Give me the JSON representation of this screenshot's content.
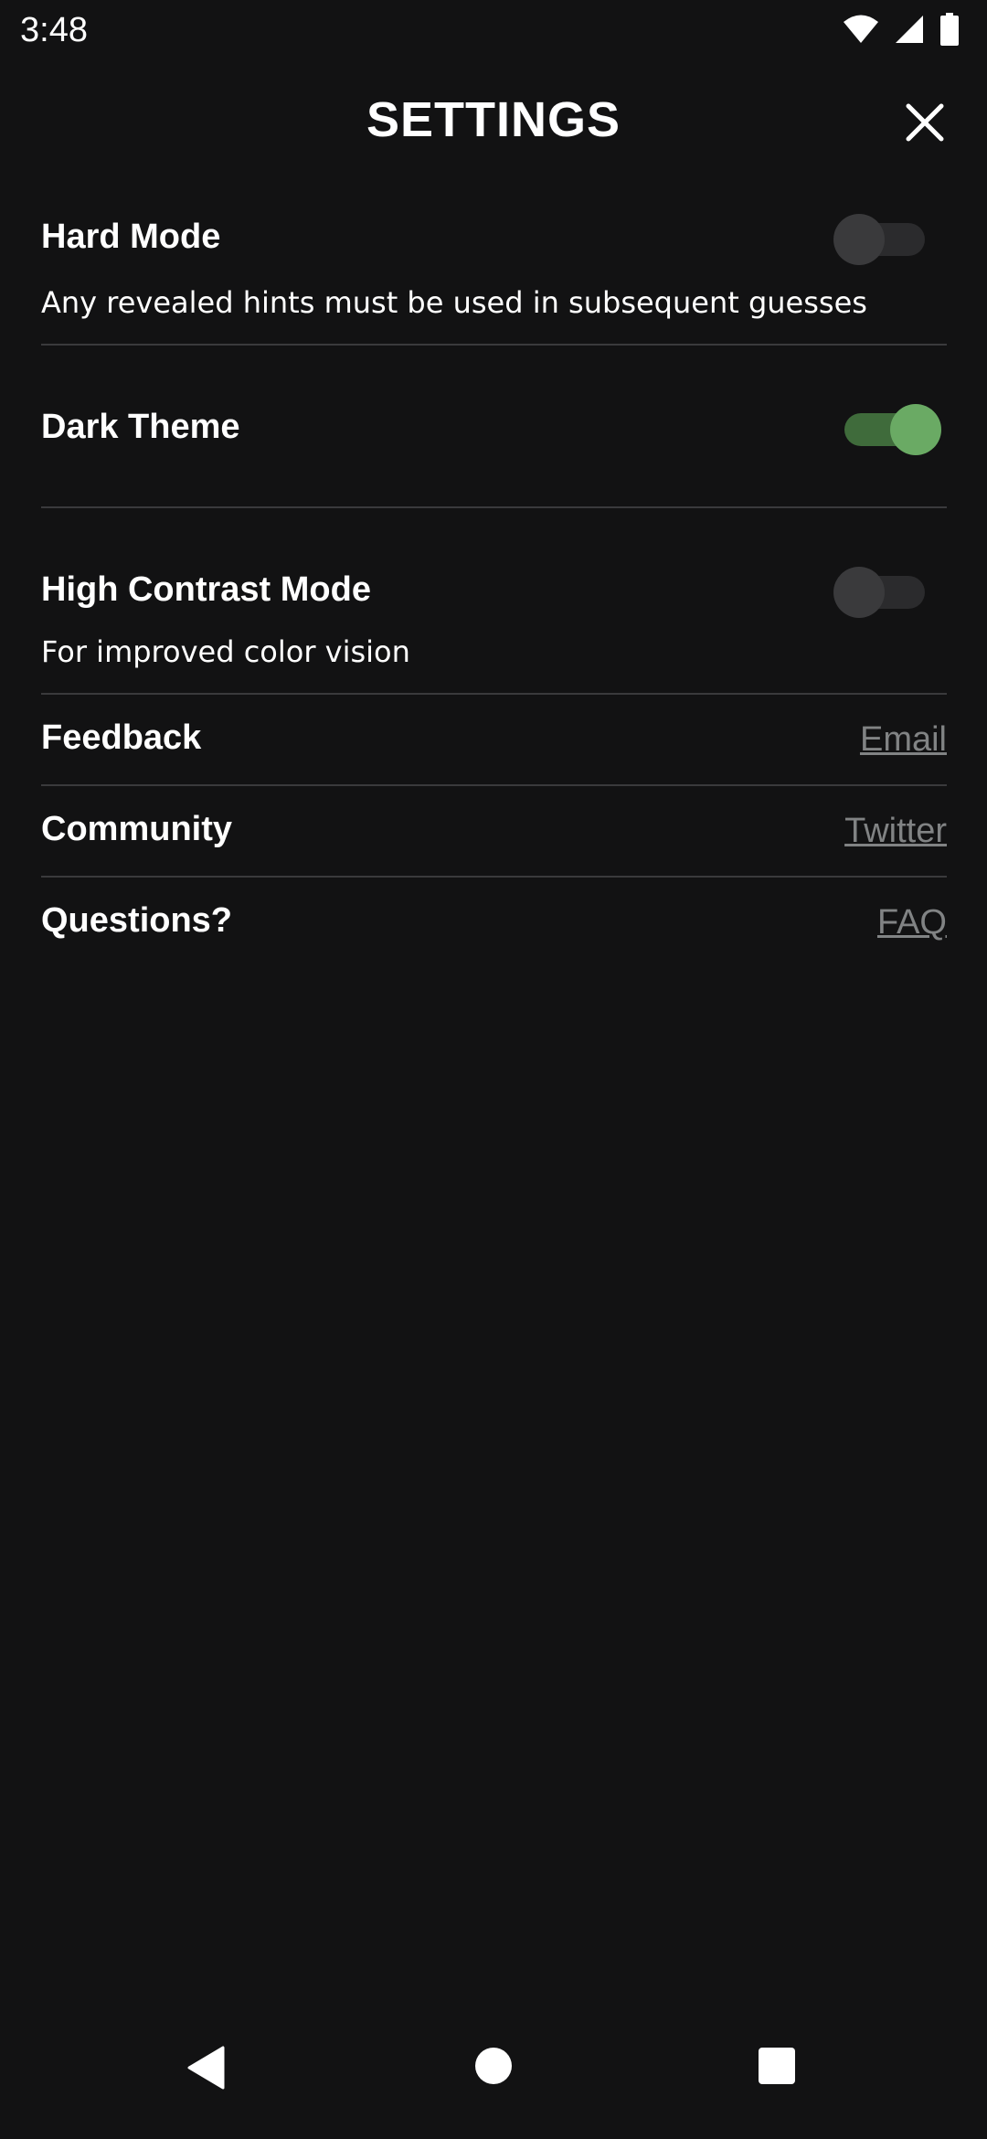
{
  "status_bar": {
    "time": "3:48",
    "icons": [
      "wifi-icon",
      "cell-signal-icon",
      "battery-icon"
    ]
  },
  "header": {
    "title": "SETTINGS",
    "close_icon": "close-icon"
  },
  "settings": [
    {
      "label": "Hard Mode",
      "description": "Any revealed hints must be used in subsequent guesses",
      "enabled": false
    },
    {
      "label": "Dark Theme",
      "description": "",
      "enabled": true
    },
    {
      "label": "High Contrast Mode",
      "description": "For improved color vision",
      "enabled": false
    }
  ],
  "links": [
    {
      "label": "Feedback",
      "link_text": "Email"
    },
    {
      "label": "Community",
      "link_text": "Twitter"
    },
    {
      "label": "Questions?",
      "link_text": "FAQ"
    }
  ],
  "colors": {
    "background": "#121213",
    "divider": "#3a3a3c",
    "toggle_on": "#6aaa64",
    "link": "#818384"
  },
  "nav_bar": {
    "icons": [
      "back-icon",
      "home-icon",
      "recents-icon"
    ]
  }
}
